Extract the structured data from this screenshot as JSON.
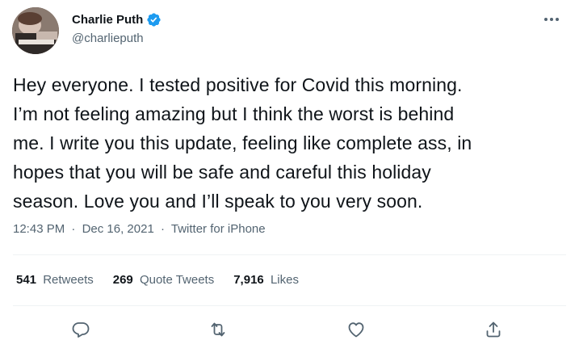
{
  "author": {
    "name": "Charlie Puth",
    "handle": "@charlieputh",
    "verified_color": "#1d9bf0"
  },
  "tweet": {
    "text": "Hey everyone. I tested positive for Covid this morning.\nI’m not feeling amazing but I think the worst is behind\nme. I write you this update, feeling like complete ass, in\nhopes that you will be safe and careful this holiday\nseason. Love you and I’ll speak to you very soon.",
    "time": "12:43 PM",
    "date": "Dec 16, 2021",
    "separator": "·",
    "source": "Twitter for iPhone"
  },
  "stats": {
    "retweets_count": "541",
    "retweets_label": "Retweets",
    "quotes_count": "269",
    "quotes_label": "Quote Tweets",
    "likes_count": "7,916",
    "likes_label": "Likes"
  },
  "icons": {
    "more": "more-horizontal-icon",
    "reply": "reply-icon",
    "retweet": "retweet-icon",
    "like": "heart-icon",
    "share": "share-icon"
  },
  "colors": {
    "text": "#0f1419",
    "secondary": "#536471",
    "divider": "#eff3f4",
    "accent": "#1d9bf0"
  }
}
